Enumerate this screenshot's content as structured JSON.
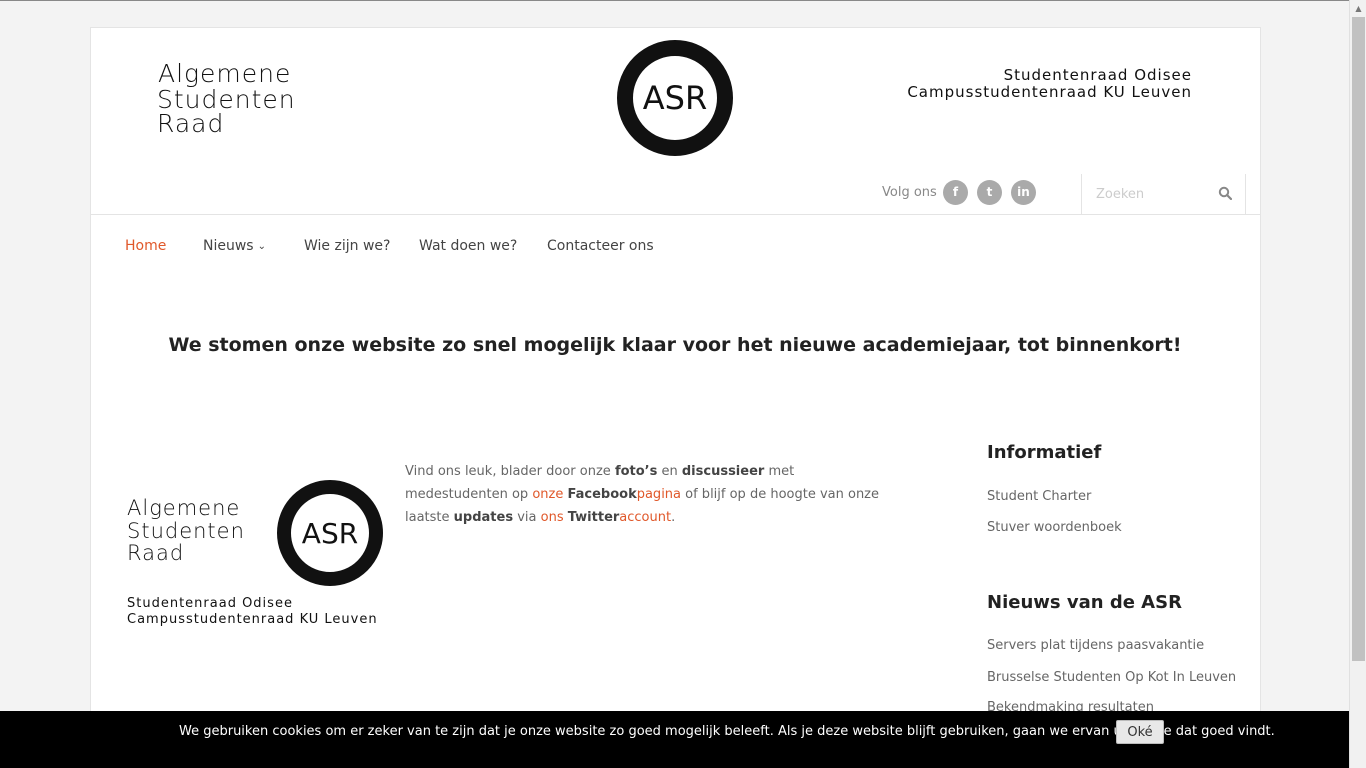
{
  "header": {
    "brand_line1": "Algemene",
    "brand_line2": "Studenten",
    "brand_line3": "Raad",
    "logo_text": "ASR",
    "org_line1": "Studentenraad  Odisee",
    "org_line2": "Campusstudentenraad KU Leuven",
    "follow_label": "Volg ons",
    "social": [
      {
        "name": "facebook",
        "glyph": "f"
      },
      {
        "name": "twitter",
        "glyph": "t"
      },
      {
        "name": "linkedin",
        "glyph": "in"
      }
    ],
    "search_placeholder": "Zoeken"
  },
  "nav": {
    "items": [
      {
        "label": "Home",
        "active": true
      },
      {
        "label": "Nieuws",
        "has_dropdown": true
      },
      {
        "label": "Wie zijn we?"
      },
      {
        "label": "Wat doen we?"
      },
      {
        "label": "Contacteer ons"
      }
    ]
  },
  "main": {
    "headline": "We stomen onze website zo snel mogelijk klaar voor het nieuwe academiejaar, tot binnenkort!",
    "footer_logo": {
      "line1": "Algemene",
      "line2": "Studenten",
      "line3": "Raad",
      "logo_text": "ASR",
      "org_line1": "Studentenraad  Odisee",
      "org_line2": "Campusstudentenraad KU Leuven"
    },
    "social_text": {
      "t1": "Vind ons leuk, blader door onze ",
      "b1": "foto’s",
      "t2": " en ",
      "b2": "discussieer",
      "t3": " met medestudenten op ",
      "link1_pre": "onze ",
      "link1_bold": "Facebook",
      "link1_post": "pagina",
      "t4": " of blijf op de hoogte van onze laatste ",
      "b3": "updates",
      "t5": " via ",
      "link2_pre": "ons ",
      "link2_bold": "Twitter",
      "link2_post": "account",
      "t6": "."
    }
  },
  "sidebar": {
    "informatief_title": "Informatief",
    "informatief_links": [
      "Student Charter",
      "Stuver woordenboek"
    ],
    "news_title": "Nieuws van de ASR",
    "news_links": [
      "Servers plat tijdens paasvakantie",
      "Brusselse Studenten Op Kot In Leuven",
      "Bekendmaking resultaten"
    ]
  },
  "cookie": {
    "text": "We gebruiken cookies om er zeker van te zijn dat je onze website zo goed mogelijk beleeft. Als je deze website blijft gebruiken, gaan we ervan uit dat je dat goed vindt.",
    "button_label": "Oké"
  },
  "colors": {
    "accent": "#e0582a",
    "social_icon_bg": "#aaaaaa",
    "cookie_bg": "#000000"
  }
}
